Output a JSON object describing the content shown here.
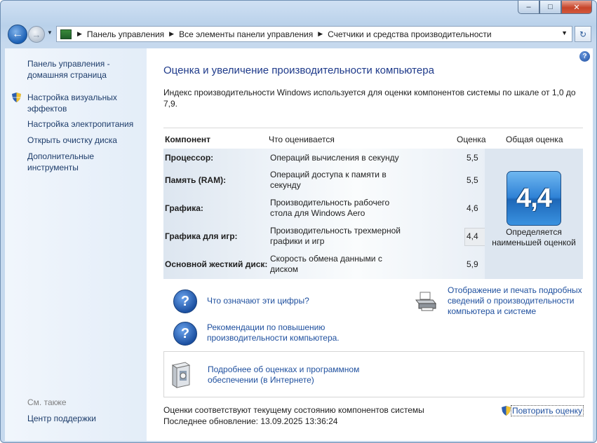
{
  "window": {
    "buttons": {
      "minimize": "–",
      "maximize": "□",
      "close": "✕"
    }
  },
  "nav": {
    "breadcrumb": [
      "Панель управления",
      "Все элементы панели управления",
      "Счетчики и средства производительности"
    ]
  },
  "sidebar": {
    "home": "Панель управления - домашняя страница",
    "links": [
      {
        "label": "Настройка визуальных эффектов",
        "shield": true
      },
      {
        "label": "Настройка электропитания",
        "shield": false
      },
      {
        "label": "Открыть очистку диска",
        "shield": false
      },
      {
        "label": "Дополнительные инструменты",
        "shield": false
      }
    ],
    "see_also": "См. также",
    "support": "Центр поддержки"
  },
  "main": {
    "title": "Оценка и увеличение производительности компьютера",
    "description": "Индекс производительности Windows используется для оценки компонентов системы по шкале от 1,0 до 7,9.",
    "table": {
      "headers": {
        "component": "Компонент",
        "rated": "Что оценивается",
        "score": "Оценка",
        "base": "Общая оценка"
      },
      "rows": [
        {
          "name": "Процессор:",
          "desc": "Операций вычисления в секунду",
          "score": "5,5"
        },
        {
          "name": "Память (RAM):",
          "desc": "Операций доступа к памяти в секунду",
          "score": "5,5"
        },
        {
          "name": "Графика:",
          "desc": "Производительность рабочего стола для Windows Aero",
          "score": "4,6"
        },
        {
          "name": "Графика для игр:",
          "desc": "Производительность трехмерной графики и игр",
          "score": "4,4"
        },
        {
          "name": "Основной жесткий диск:",
          "desc": "Скорость обмена данными с диском",
          "score": "5,9"
        }
      ],
      "base_score": "4,4",
      "base_note": "Определяется наименьшей оценкой"
    },
    "links": {
      "numbers": "Что означают эти цифры?",
      "tips": "Рекомендации по повышению производительности компьютера.",
      "print": "Отображение и печать подробных сведений о производительности компьютера и системе",
      "online": "Подробнее об оценках и программном обеспечении (в Интернете)"
    },
    "footer": {
      "status": "Оценки соответствуют текущему состоянию компонентов системы",
      "last_update": "Последнее обновление: 13.09.2025 13:36:24",
      "rerun": "Повторить оценку"
    }
  }
}
